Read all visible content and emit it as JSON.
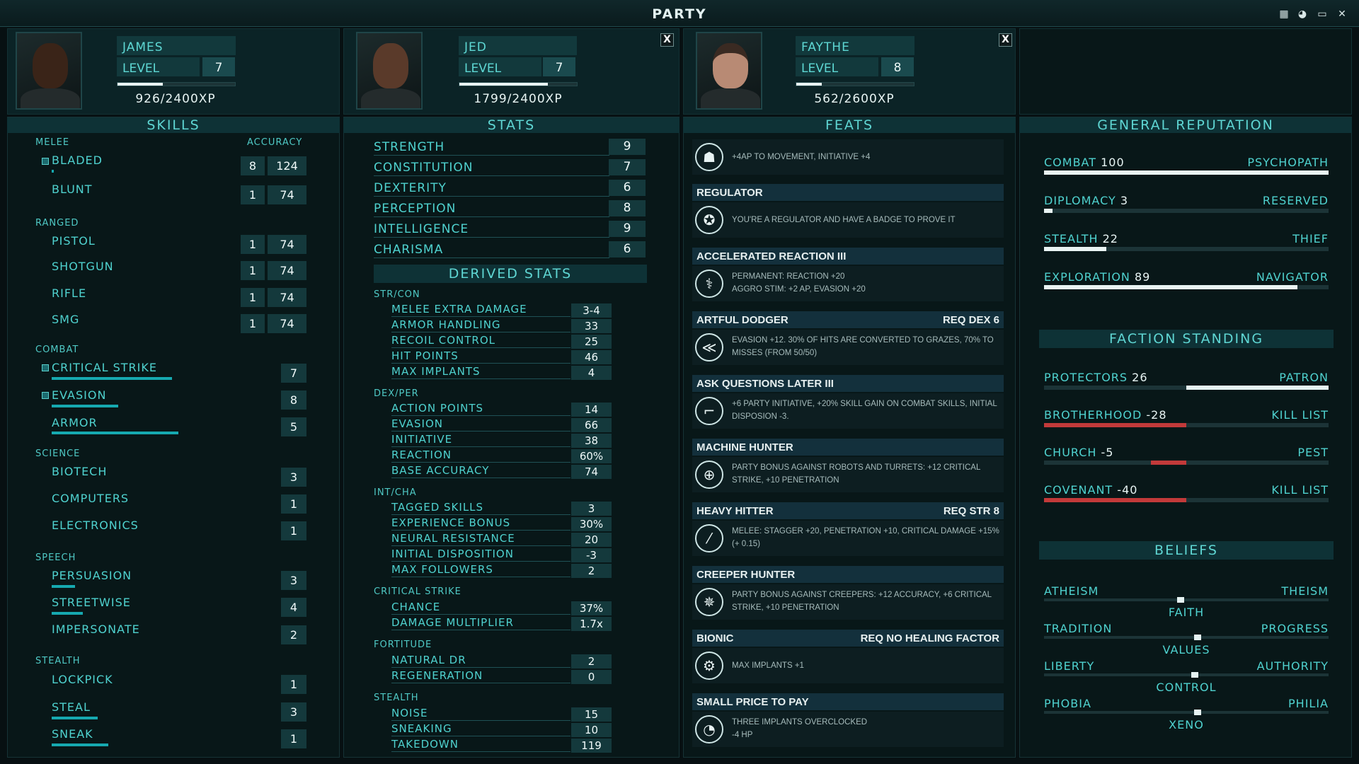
{
  "window": {
    "title": "PARTY"
  },
  "members": [
    {
      "name": "JAMES",
      "level_label": "LEVEL",
      "level": "7",
      "xp_text": "926/2400XP",
      "xp_fraction": 0.386
    },
    {
      "name": "JED",
      "level_label": "LEVEL",
      "level": "7",
      "xp_text": "1799/2400XP",
      "xp_fraction": 0.75
    },
    {
      "name": "FAYTHE",
      "level_label": "LEVEL",
      "level": "8",
      "xp_text": "562/2600XP",
      "xp_fraction": 0.216
    }
  ],
  "close_label": "X",
  "skills": {
    "title": "SKILLS",
    "accuracy_label": "ACCURACY",
    "categories": [
      {
        "name": "MELEE",
        "items": [
          {
            "name": "BLADED",
            "tagged": true,
            "value": "8",
            "accuracy": "124",
            "bar": 0.02
          },
          {
            "name": "BLUNT",
            "tagged": false,
            "value": "1",
            "accuracy": "74",
            "bar": 0
          }
        ]
      },
      {
        "name": "RANGED",
        "items": [
          {
            "name": "PISTOL",
            "value": "1",
            "accuracy": "74"
          },
          {
            "name": "SHOTGUN",
            "value": "1",
            "accuracy": "74"
          },
          {
            "name": "RIFLE",
            "value": "1",
            "accuracy": "74"
          },
          {
            "name": "SMG",
            "value": "1",
            "accuracy": "74"
          }
        ]
      },
      {
        "name": "COMBAT",
        "items": [
          {
            "name": "CRITICAL STRIKE",
            "tagged": true,
            "value": "7",
            "bar": 0.6
          },
          {
            "name": "EVASION",
            "tagged": true,
            "value": "8",
            "bar": 0.34
          },
          {
            "name": "ARMOR",
            "tagged": false,
            "value": "5",
            "bar": 0.6
          }
        ]
      },
      {
        "name": "SCIENCE",
        "items": [
          {
            "name": "BIOTECH",
            "value": "3"
          },
          {
            "name": "COMPUTERS",
            "value": "1"
          },
          {
            "name": "ELECTRONICS",
            "value": "1"
          }
        ]
      },
      {
        "name": "SPEECH",
        "items": [
          {
            "name": "PERSUASION",
            "value": "3",
            "bar": 0.12
          },
          {
            "name": "STREETWISE",
            "value": "4",
            "bar": 0.16
          },
          {
            "name": "IMPERSONATE",
            "value": "2",
            "bar": 0
          }
        ]
      },
      {
        "name": "STEALTH",
        "items": [
          {
            "name": "LOCKPICK",
            "value": "1",
            "bar": 0
          },
          {
            "name": "STEAL",
            "value": "3",
            "bar": 0.23
          },
          {
            "name": "SNEAK",
            "value": "1",
            "bar": 0.28
          }
        ]
      }
    ]
  },
  "stats": {
    "title": "STATS",
    "primary": [
      {
        "name": "STRENGTH",
        "value": "9"
      },
      {
        "name": "CONSTITUTION",
        "value": "7"
      },
      {
        "name": "DEXTERITY",
        "value": "6"
      },
      {
        "name": "PERCEPTION",
        "value": "8"
      },
      {
        "name": "INTELLIGENCE",
        "value": "9"
      },
      {
        "name": "CHARISMA",
        "value": "6"
      }
    ],
    "derived_title": "DERIVED STATS",
    "derived": [
      {
        "group": "STR/CON",
        "items": [
          {
            "name": "MELEE EXTRA DAMAGE",
            "value": "3-4"
          },
          {
            "name": "ARMOR HANDLING",
            "value": "33"
          },
          {
            "name": "RECOIL CONTROL",
            "value": "25"
          },
          {
            "name": "HIT POINTS",
            "value": "46"
          },
          {
            "name": "MAX IMPLANTS",
            "value": "4"
          }
        ]
      },
      {
        "group": "DEX/PER",
        "items": [
          {
            "name": "ACTION POINTS",
            "value": "14"
          },
          {
            "name": "EVASION",
            "value": "66"
          },
          {
            "name": "INITIATIVE",
            "value": "38"
          },
          {
            "name": "REACTION",
            "value": "60%"
          },
          {
            "name": "BASE ACCURACY",
            "value": "74"
          }
        ]
      },
      {
        "group": "INT/CHA",
        "items": [
          {
            "name": "TAGGED SKILLS",
            "value": "3"
          },
          {
            "name": "EXPERIENCE BONUS",
            "value": "30%"
          },
          {
            "name": "NEURAL RESISTANCE",
            "value": "20"
          },
          {
            "name": "INITIAL DISPOSITION",
            "value": "-3"
          },
          {
            "name": "MAX FOLLOWERS",
            "value": "2"
          }
        ]
      },
      {
        "group": "CRITICAL STRIKE",
        "items": [
          {
            "name": "CHANCE",
            "value": "37%"
          },
          {
            "name": "DAMAGE MULTIPLIER",
            "value": "1.7x"
          }
        ]
      },
      {
        "group": "FORTITUDE",
        "items": [
          {
            "name": "NATURAL DR",
            "value": "2"
          },
          {
            "name": "REGENERATION",
            "value": "0"
          }
        ]
      },
      {
        "group": "STEALTH",
        "items": [
          {
            "name": "NOISE",
            "value": "15"
          },
          {
            "name": "SNEAKING",
            "value": "10"
          },
          {
            "name": "TAKEDOWN",
            "value": "119"
          }
        ]
      }
    ]
  },
  "feats": {
    "title": "FEATS",
    "items": [
      {
        "name": "",
        "req": "",
        "icon": "helmet-icon",
        "glyph": "☗",
        "desc": "+4AP TO MOVEMENT, INITIATIVE +4"
      },
      {
        "name": "REGULATOR",
        "req": "",
        "icon": "badge-icon",
        "glyph": "✪",
        "desc": "YOU'RE A REGULATOR AND HAVE A BADGE TO PROVE IT"
      },
      {
        "name": "ACCELERATED REACTION III",
        "req": "",
        "icon": "dna-icon",
        "glyph": "⚕",
        "desc": "PERMANENT: REACTION +20\nAGGRO STIM: +2 AP, EVASION +20"
      },
      {
        "name": "ARTFUL DODGER",
        "req": "REQ DEX 6",
        "icon": "dodge-arrows-icon",
        "glyph": "≪",
        "desc": "EVASION +12. 30% OF HITS ARE CONVERTED TO GRAZES, 70% TO MISSES (FROM 50/50)"
      },
      {
        "name": "ASK QUESTIONS LATER III",
        "req": "",
        "icon": "gun-icon",
        "glyph": "⌐",
        "desc": "+6 PARTY INITIATIVE, +20% SKILL GAIN ON COMBAT SKILLS, INITIAL DISPOSION -3."
      },
      {
        "name": "MACHINE HUNTER",
        "req": "",
        "icon": "robot-target-icon",
        "glyph": "⊕",
        "desc": "PARTY BONUS AGAINST ROBOTS AND TURRETS: +12 CRITICAL STRIKE, +10 PENETRATION"
      },
      {
        "name": "HEAVY HITTER",
        "req": "REQ STR 8",
        "icon": "bat-icon",
        "glyph": "⁄",
        "desc": "MELEE: STAGGER +20, PENETRATION +10, CRITICAL DAMAGE +15% (+ 0.15)"
      },
      {
        "name": "CREEPER HUNTER",
        "req": "",
        "icon": "creeper-target-icon",
        "glyph": "✵",
        "desc": "PARTY BONUS AGAINST CREEPERS: +12 ACCURACY, +6 CRITICAL STRIKE, +10 PENETRATION"
      },
      {
        "name": "BIONIC",
        "req": "REQ NO HEALING FACTOR",
        "icon": "bionic-head-icon",
        "glyph": "⚙",
        "desc": "MAX IMPLANTS +1"
      },
      {
        "name": "SMALL PRICE TO PAY",
        "req": "",
        "icon": "gauge-icon",
        "glyph": "◔",
        "desc": "THREE IMPLANTS OVERCLOCKED\n-4 HP"
      }
    ]
  },
  "reputation": {
    "title": "GENERAL REPUTATION",
    "items": [
      {
        "name": "COMBAT",
        "value": "100",
        "rank": "PSYCHOPATH",
        "fill": 1.0,
        "color": "#e6f3f2",
        "from_center": false
      },
      {
        "name": "DIPLOMACY",
        "value": "3",
        "rank": "RESERVED",
        "fill": 0.03,
        "color": "#e6f3f2",
        "from_center": false
      },
      {
        "name": "STEALTH",
        "value": "22",
        "rank": "THIEF",
        "fill": 0.22,
        "color": "#e6f3f2",
        "from_center": false
      },
      {
        "name": "EXPLORATION",
        "value": "89",
        "rank": "NAVIGATOR",
        "fill": 0.89,
        "color": "#e6f3f2",
        "from_center": false
      }
    ]
  },
  "factions": {
    "title": "FACTION STANDING",
    "items": [
      {
        "name": "PROTECTORS",
        "value": "26",
        "rank": "PATRON",
        "fill": 1.0,
        "color": "#e6f3f2",
        "direction": "right"
      },
      {
        "name": "BROTHERHOOD",
        "value": "-28",
        "rank": "KILL LIST",
        "fill": 1.0,
        "color": "#c23a3a",
        "direction": "left"
      },
      {
        "name": "CHURCH",
        "value": "-5",
        "rank": "PEST",
        "fill": 0.25,
        "color": "#c23a3a",
        "direction": "left"
      },
      {
        "name": "COVENANT",
        "value": "-40",
        "rank": "KILL LIST",
        "fill": 1.0,
        "color": "#c23a3a",
        "direction": "left"
      }
    ]
  },
  "beliefs": {
    "title": "BELIEFS",
    "items": [
      {
        "left": "ATHEISM",
        "right": "THEISM",
        "center": "FAITH",
        "position": 0.48
      },
      {
        "left": "TRADITION",
        "right": "PROGRESS",
        "center": "VALUES",
        "position": 0.54
      },
      {
        "left": "LIBERTY",
        "right": "AUTHORITY",
        "center": "CONTROL",
        "position": 0.53
      },
      {
        "left": "PHOBIA",
        "right": "PHILIA",
        "center": "XENO",
        "position": 0.54
      }
    ]
  },
  "colors": {
    "accent": "#4fd2cf",
    "negative": "#c23a3a",
    "panel": "#0b2326"
  }
}
